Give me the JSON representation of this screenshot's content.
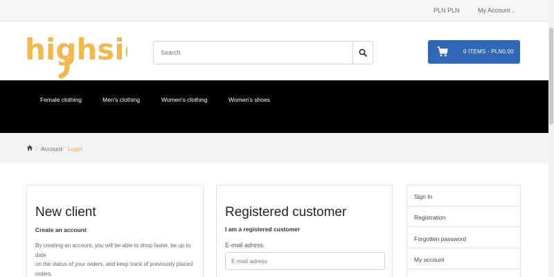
{
  "topbar": {
    "currency": "PLN PLN",
    "account": "My Account"
  },
  "brand": {
    "logo_text": "highsid",
    "logo_color": "#f0b84e"
  },
  "search": {
    "placeholder": "Search"
  },
  "cart": {
    "label": "0 ITEMS - PLN0.00",
    "color": "#3067b6"
  },
  "nav": {
    "items": [
      "Female clothing",
      "Men's clothing",
      "Women's clothing",
      "Women's shoes"
    ]
  },
  "breadcrumb": {
    "items": [
      "Account",
      "Login"
    ]
  },
  "new_client": {
    "title": "New client",
    "subtitle": "Create an account",
    "text_lines": [
      "By creating an account, you will be able to shop faster, be up to date",
      "on the status of your orders, and keep track of previously placed",
      "orders."
    ]
  },
  "registered": {
    "title": "Registered customer",
    "subtitle": "I am a registered customer",
    "email_label": "E-mail adress",
    "email_placeholder": "E-mail adress"
  },
  "side_menu": {
    "items": [
      "Sign In",
      "Registration",
      "Forgotten password",
      "My account"
    ]
  }
}
